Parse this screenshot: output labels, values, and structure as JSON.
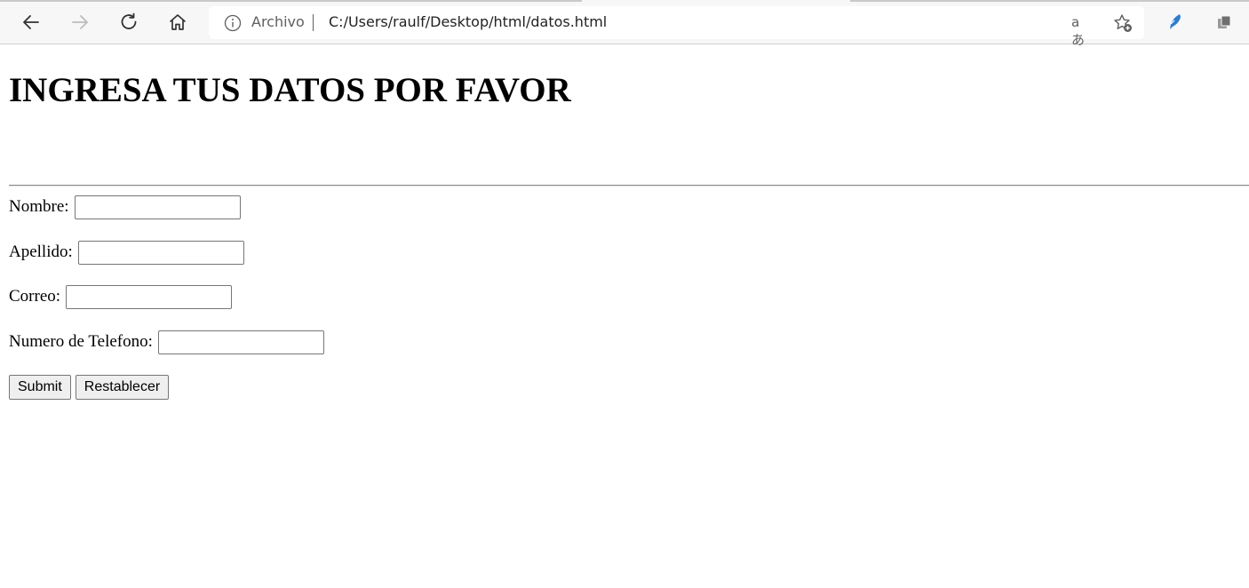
{
  "browser": {
    "site_label": "Archivo",
    "url": "C:/Users/raulf/Desktop/html/datos.html",
    "read_aloud_glyph": "aあ",
    "icons": [
      "back-icon",
      "forward-icon",
      "refresh-icon",
      "home-icon",
      "info-icon",
      "read-aloud-icon",
      "add-favorite-icon",
      "extension-icon",
      "collections-icon"
    ]
  },
  "page": {
    "title": "INGRESA TUS DATOS POR FAVOR",
    "fields": {
      "nombre": {
        "label": "Nombre:",
        "value": ""
      },
      "apellido": {
        "label": "Apellido:",
        "value": ""
      },
      "correo": {
        "label": "Correo:",
        "value": ""
      },
      "telefono": {
        "label": "Numero de Telefono:",
        "value": ""
      }
    },
    "submit_label": "Submit",
    "reset_label": "Restablecer"
  }
}
